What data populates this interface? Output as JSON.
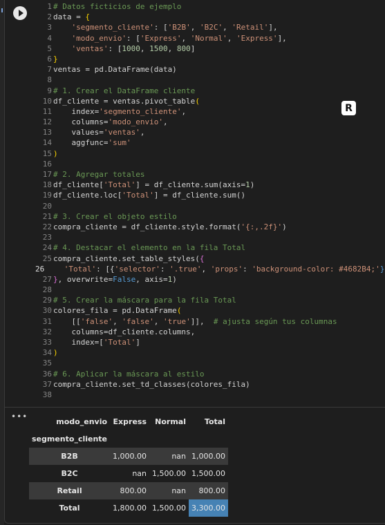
{
  "code_lines": [
    [
      {
        "t": "# Datos ficticios de ejemplo",
        "c": "c"
      }
    ],
    [
      {
        "t": "data = ",
        "c": "k"
      },
      {
        "t": "{",
        "c": "p"
      }
    ],
    [
      {
        "t": "    ",
        "c": "k"
      },
      {
        "t": "'segmento_cliente'",
        "c": "s"
      },
      {
        "t": ": [",
        "c": "k"
      },
      {
        "t": "'B2B'",
        "c": "s"
      },
      {
        "t": ", ",
        "c": "k"
      },
      {
        "t": "'B2C'",
        "c": "s"
      },
      {
        "t": ", ",
        "c": "k"
      },
      {
        "t": "'Retail'",
        "c": "s"
      },
      {
        "t": "],",
        "c": "k"
      }
    ],
    [
      {
        "t": "    ",
        "c": "k"
      },
      {
        "t": "'modo_envio'",
        "c": "s"
      },
      {
        "t": ": [",
        "c": "k"
      },
      {
        "t": "'Express'",
        "c": "s"
      },
      {
        "t": ", ",
        "c": "k"
      },
      {
        "t": "'Normal'",
        "c": "s"
      },
      {
        "t": ", ",
        "c": "k"
      },
      {
        "t": "'Express'",
        "c": "s"
      },
      {
        "t": "],",
        "c": "k"
      }
    ],
    [
      {
        "t": "    ",
        "c": "k"
      },
      {
        "t": "'ventas'",
        "c": "s"
      },
      {
        "t": ": [",
        "c": "k"
      },
      {
        "t": "1000",
        "c": "n"
      },
      {
        "t": ", ",
        "c": "k"
      },
      {
        "t": "1500",
        "c": "n"
      },
      {
        "t": ", ",
        "c": "k"
      },
      {
        "t": "800",
        "c": "n"
      },
      {
        "t": "]",
        "c": "k"
      }
    ],
    [
      {
        "t": "}",
        "c": "p"
      }
    ],
    [
      {
        "t": "ventas = pd.DataFrame(data)",
        "c": "k"
      }
    ],
    [],
    [
      {
        "t": "# 1. Crear el DataFrame cliente",
        "c": "c"
      }
    ],
    [
      {
        "t": "df_cliente = ventas.pivot_table",
        "c": "k"
      },
      {
        "t": "(",
        "c": "p"
      }
    ],
    [
      {
        "t": "    index=",
        "c": "k"
      },
      {
        "t": "'segmento_cliente'",
        "c": "s"
      },
      {
        "t": ",",
        "c": "k"
      }
    ],
    [
      {
        "t": "    columns=",
        "c": "k"
      },
      {
        "t": "'modo_envio'",
        "c": "s"
      },
      {
        "t": ",",
        "c": "k"
      }
    ],
    [
      {
        "t": "    values=",
        "c": "k"
      },
      {
        "t": "'ventas'",
        "c": "s"
      },
      {
        "t": ",",
        "c": "k"
      }
    ],
    [
      {
        "t": "    aggfunc=",
        "c": "k"
      },
      {
        "t": "'sum'",
        "c": "s"
      }
    ],
    [
      {
        "t": ")",
        "c": "p"
      }
    ],
    [],
    [
      {
        "t": "# 2. Agregar totales",
        "c": "c"
      }
    ],
    [
      {
        "t": "df_cliente[",
        "c": "k"
      },
      {
        "t": "'Total'",
        "c": "s"
      },
      {
        "t": "] = df_cliente.sum(axis=",
        "c": "k"
      },
      {
        "t": "1",
        "c": "n"
      },
      {
        "t": ")",
        "c": "k"
      }
    ],
    [
      {
        "t": "df_cliente.loc[",
        "c": "k"
      },
      {
        "t": "'Total'",
        "c": "s"
      },
      {
        "t": "] = df_cliente.sum()",
        "c": "k"
      }
    ],
    [],
    [
      {
        "t": "# 3. Crear el objeto estilo",
        "c": "c"
      }
    ],
    [
      {
        "t": "compra_cliente = df_cliente.style.format(",
        "c": "k"
      },
      {
        "t": "'{:,.2f}'",
        "c": "s"
      },
      {
        "t": ")",
        "c": "k"
      }
    ],
    [],
    [
      {
        "t": "# 4. Destacar el elemento en la fila Total",
        "c": "c"
      }
    ],
    [
      {
        "t": "compra_cliente.set_table_styles(",
        "c": "k"
      },
      {
        "t": "{",
        "c": "p2"
      }
    ],
    [
      {
        "t": "    ",
        "c": "k"
      },
      {
        "t": "'Total'",
        "c": "s"
      },
      {
        "t": ": [{",
        "c": "k"
      },
      {
        "t": "'selector'",
        "c": "s"
      },
      {
        "t": ": ",
        "c": "k"
      },
      {
        "t": "'.true'",
        "c": "s"
      },
      {
        "t": ", ",
        "c": "k"
      },
      {
        "t": "'props'",
        "c": "s"
      },
      {
        "t": ": ",
        "c": "k"
      },
      {
        "t": "'background-color: #4682B4;'",
        "c": "s"
      },
      {
        "t": "}]",
        "c": "b"
      }
    ],
    [
      {
        "t": "}",
        "c": "p2"
      },
      {
        "t": ", overwrite=",
        "c": "k"
      },
      {
        "t": "False",
        "c": "b"
      },
      {
        "t": ", axis=",
        "c": "k"
      },
      {
        "t": "1",
        "c": "n"
      },
      {
        "t": ")",
        "c": "k"
      }
    ],
    [],
    [
      {
        "t": "# 5. Crear la máscara para la fila Total",
        "c": "c"
      }
    ],
    [
      {
        "t": "colores_fila = pd.DataFrame",
        "c": "k"
      },
      {
        "t": "(",
        "c": "p"
      }
    ],
    [
      {
        "t": "    [[",
        "c": "k"
      },
      {
        "t": "'false'",
        "c": "s"
      },
      {
        "t": ", ",
        "c": "k"
      },
      {
        "t": "'false'",
        "c": "s"
      },
      {
        "t": ", ",
        "c": "k"
      },
      {
        "t": "'true'",
        "c": "s"
      },
      {
        "t": "]],  ",
        "c": "k"
      },
      {
        "t": "# ajusta según tus columnas",
        "c": "c"
      }
    ],
    [
      {
        "t": "    columns=df_cliente.columns,",
        "c": "k"
      }
    ],
    [
      {
        "t": "    index=[",
        "c": "k"
      },
      {
        "t": "'Total'",
        "c": "s"
      },
      {
        "t": "]",
        "c": "k"
      }
    ],
    [
      {
        "t": ")",
        "c": "p"
      }
    ],
    [],
    [
      {
        "t": "# 6. Aplicar la máscara al estilo",
        "c": "c"
      }
    ],
    [
      {
        "t": "compra_cliente.set_td_classes(colores_fila)",
        "c": "k"
      }
    ],
    []
  ],
  "active_line": 26,
  "badge_text": "R",
  "output": {
    "dots": "•••",
    "columns_name": "modo_envio",
    "columns": [
      "Express",
      "Normal",
      "Total"
    ],
    "index_name": "segmento_cliente",
    "rows": [
      {
        "label": "B2B",
        "values": [
          "1,000.00",
          "nan",
          "1,000.00"
        ]
      },
      {
        "label": "B2C",
        "values": [
          "nan",
          "1,500.00",
          "1,500.00"
        ]
      },
      {
        "label": "Retail",
        "values": [
          "800.00",
          "nan",
          "800.00"
        ]
      },
      {
        "label": "Total",
        "values": [
          "1,800.00",
          "1,500.00",
          "3,300.00"
        ]
      }
    ],
    "highlight_color": "#4682B4"
  }
}
